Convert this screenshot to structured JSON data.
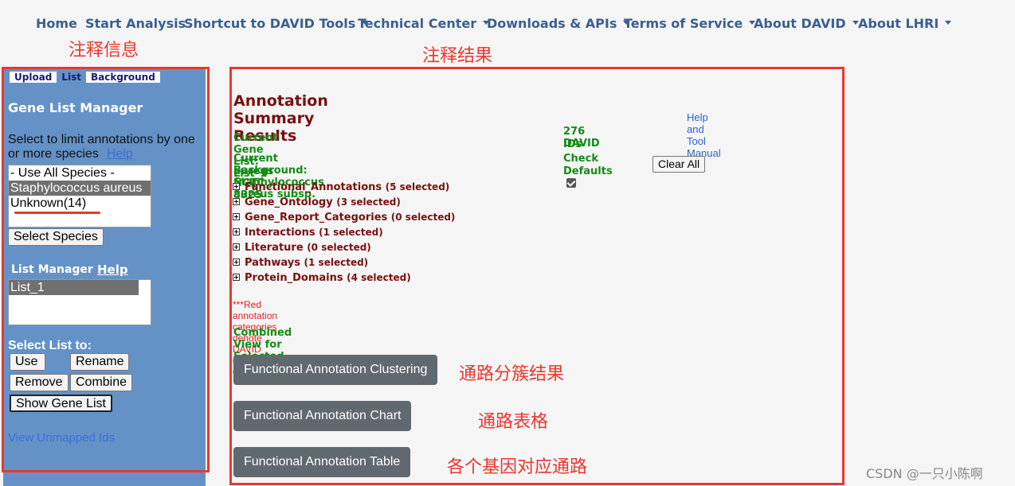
{
  "nav": {
    "items": [
      {
        "label": "Home",
        "dropdown": false
      },
      {
        "label": "Start Analysis",
        "dropdown": false
      },
      {
        "label": "Shortcut to DAVID Tools",
        "dropdown": true
      },
      {
        "label": "Technical Center",
        "dropdown": true
      },
      {
        "label": "Downloads & APIs",
        "dropdown": true
      },
      {
        "label": "Terms of Service",
        "dropdown": true
      },
      {
        "label": "About DAVID",
        "dropdown": true
      },
      {
        "label": "About LHRI",
        "dropdown": true
      }
    ]
  },
  "annotations": {
    "left_label": "注释信息",
    "right_label": "注释结果",
    "clustering_note": "通路分簇结果",
    "chart_note": "通路表格",
    "table_note": "各个基因对应通路",
    "color": "#e8382f"
  },
  "sidebar": {
    "tabs": [
      "Upload",
      "List",
      "Background"
    ],
    "active_tab": "List",
    "title": "Gene List Manager",
    "species_prompt": "Select to limit annotations by one or more species",
    "species_help": "Help",
    "species_options": [
      {
        "label": "- Use All Species -",
        "selected": false
      },
      {
        "label": "Staphylococcus aureus",
        "selected": true
      },
      {
        "label": "Unknown(14)",
        "selected": false
      }
    ],
    "select_species_button": "Select Species",
    "list_manager_title": "List Manager",
    "list_manager_help": "Help",
    "lists": [
      {
        "label": "List_1",
        "selected": true
      }
    ],
    "select_list_to": "Select List to:",
    "use_button": "Use",
    "rename_button": "Rename",
    "remove_button": "Remove",
    "combine_button": "Combine",
    "show_gene_list_button": "Show Gene List",
    "view_unmapped_link": "View Unmapped Ids",
    "bg_color": "#6492c7"
  },
  "main": {
    "title": "Annotation Summary Results",
    "help_manual_link": "Help and Tool Manual",
    "current_gene_list": "Current Gene List: List_1",
    "david_ids": "276 DAVID",
    "ids_label": "IDs",
    "current_background_line1": "Current Background: Staphylococcus aureus subsp.",
    "current_background_line2": "aureus NCTC 8325",
    "check_label": "Check",
    "defaults_label": "Defaults",
    "defaults_checked": true,
    "clear_all_button": "Clear All",
    "categories": [
      {
        "name": "Functional_Annotations",
        "count": "(5 selected)"
      },
      {
        "name": "Gene_Ontology",
        "count": "(3 selected)"
      },
      {
        "name": "Gene_Report_Categories",
        "count": "(0 selected)"
      },
      {
        "name": "Interactions",
        "count": "(1 selected)"
      },
      {
        "name": "Literature",
        "count": "(0 selected)"
      },
      {
        "name": "Pathways",
        "count": "(1 selected)"
      },
      {
        "name": "Protein_Domains",
        "count": "(4 selected)"
      }
    ],
    "red_note": "***Red annotation categories denote DAVID defined defaults***",
    "combined_view": "Combined View for Selected Annotation",
    "clustering_button": "Functional Annotation Clustering",
    "chart_button": "Functional Annotation Chart",
    "table_button": "Functional Annotation Table"
  },
  "watermark": "CSDN @一只小陈啊"
}
